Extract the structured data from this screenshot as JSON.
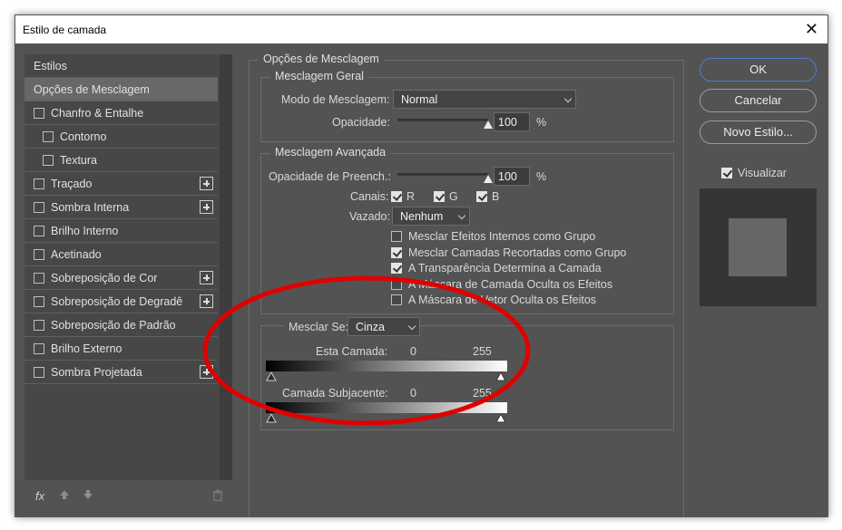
{
  "window": {
    "title": "Estilo de camada",
    "close_glyph": "✕"
  },
  "styles_list": {
    "header": "Estilos",
    "items": [
      {
        "label": "Opções de Mesclagem",
        "checkbox": false,
        "active": true,
        "indent": false,
        "plus": false
      },
      {
        "label": "Chanfro & Entalhe",
        "checkbox": true,
        "active": false,
        "indent": false,
        "plus": false
      },
      {
        "label": "Contorno",
        "checkbox": true,
        "active": false,
        "indent": true,
        "plus": false
      },
      {
        "label": "Textura",
        "checkbox": true,
        "active": false,
        "indent": true,
        "plus": false
      },
      {
        "label": "Traçado",
        "checkbox": true,
        "active": false,
        "indent": false,
        "plus": true
      },
      {
        "label": "Sombra Interna",
        "checkbox": true,
        "active": false,
        "indent": false,
        "plus": true
      },
      {
        "label": "Brilho Interno",
        "checkbox": true,
        "active": false,
        "indent": false,
        "plus": false
      },
      {
        "label": "Acetinado",
        "checkbox": true,
        "active": false,
        "indent": false,
        "plus": false
      },
      {
        "label": "Sobreposição de Cor",
        "checkbox": true,
        "active": false,
        "indent": false,
        "plus": true
      },
      {
        "label": "Sobreposição de Degradê",
        "checkbox": true,
        "active": false,
        "indent": false,
        "plus": true
      },
      {
        "label": "Sobreposição de Padrão",
        "checkbox": true,
        "active": false,
        "indent": false,
        "plus": false
      },
      {
        "label": "Brilho Externo",
        "checkbox": true,
        "active": false,
        "indent": false,
        "plus": false
      },
      {
        "label": "Sombra Projetada",
        "checkbox": true,
        "active": false,
        "indent": false,
        "plus": true
      }
    ],
    "footer": {
      "fx": "fx",
      "up_icon": "arrow-up-icon",
      "down_icon": "arrow-down-icon",
      "trash_icon": "trash-icon"
    }
  },
  "blending": {
    "section_title": "Opções de Mesclagem",
    "general": {
      "title": "Mesclagem Geral",
      "mode_label": "Modo de Mesclagem:",
      "mode_value": "Normal",
      "opacity_label": "Opacidade:",
      "opacity_value": "100",
      "opacity_unit": "%",
      "opacity_level": 1.0
    },
    "advanced": {
      "title": "Mesclagem Avançada",
      "fill_label": "Opacidade de Preench.:",
      "fill_value": "100",
      "fill_unit": "%",
      "fill_level": 1.0,
      "channels_label": "Canais:",
      "channels": [
        {
          "label": "R",
          "checked": true
        },
        {
          "label": "G",
          "checked": true
        },
        {
          "label": "B",
          "checked": true
        }
      ],
      "knockout_label": "Vazado:",
      "knockout_value": "Nenhum",
      "options": [
        {
          "label": "Mesclar Efeitos Internos como Grupo",
          "checked": false
        },
        {
          "label": "Mesclar Camadas Recortadas como Grupo",
          "checked": true
        },
        {
          "label": "A Transparência Determina a Camada",
          "checked": true
        },
        {
          "label": "A Máscara de Camada Oculta os Efeitos",
          "checked": false
        },
        {
          "label": "A Máscara de Vetor Oculta os Efeitos",
          "checked": false
        }
      ]
    },
    "blend_if": {
      "label": "Mesclar Se:",
      "value": "Cinza",
      "this_layer": {
        "label": "Esta Camada:",
        "low": "0",
        "high": "255"
      },
      "underlying": {
        "label": "Camada Subjacente:",
        "low": "0",
        "high": "255"
      }
    }
  },
  "buttons": {
    "ok": "OK",
    "cancel": "Cancelar",
    "new_style": "Novo Estilo...",
    "preview_label": "Visualizar",
    "preview_checked": true
  },
  "colors": {
    "dialog_bg": "#535353",
    "list_bg": "#474747",
    "active_item": "#686868",
    "primary_border": "#4d7bd1",
    "annotation": "#e00000"
  }
}
